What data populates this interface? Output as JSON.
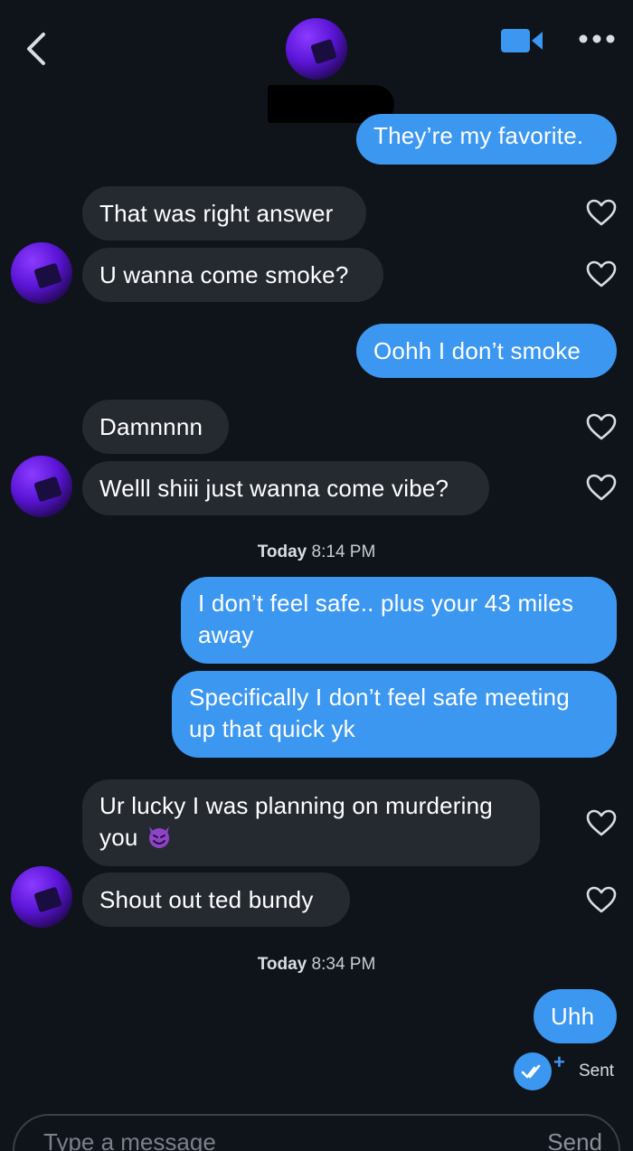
{
  "header": {
    "back_icon": "chevron-left-icon",
    "video_icon": "video-camera-icon",
    "more_icon": "ellipsis-icon",
    "accent": "#3c97f1"
  },
  "messages": [
    {
      "direction": "out",
      "text": "They’re my favorite."
    },
    {
      "direction": "in",
      "text": "That was right answer"
    },
    {
      "direction": "in",
      "text": "U wanna come smoke?"
    },
    {
      "direction": "out",
      "text": "Oohh I don’t smoke"
    },
    {
      "direction": "in",
      "text": "Damnnnn"
    },
    {
      "direction": "in",
      "text": "Welll shiii just wanna come vibe?"
    },
    {
      "direction": "out",
      "text": "I don’t feel safe.. plus your 43 miles away"
    },
    {
      "direction": "out",
      "text": "Specifically I don’t feel safe meeting up that quick yk"
    },
    {
      "direction": "in",
      "text": "Ur lucky I was planning on murdering you"
    },
    {
      "direction": "in",
      "text": "Shout out ted bundy"
    },
    {
      "direction": "out",
      "text": "Uhh"
    }
  ],
  "timestamps": [
    {
      "day": "Today",
      "time": "8:14 PM"
    },
    {
      "day": "Today",
      "time": "8:34 PM"
    }
  ],
  "status": {
    "sent_label": "Sent",
    "plus": "+"
  },
  "composer": {
    "placeholder": "Type a message",
    "send_label": "Send"
  },
  "colors": {
    "incoming_bubble": "#252a31",
    "outgoing_bubble": "#3c97f1",
    "background": "#0f141b"
  }
}
